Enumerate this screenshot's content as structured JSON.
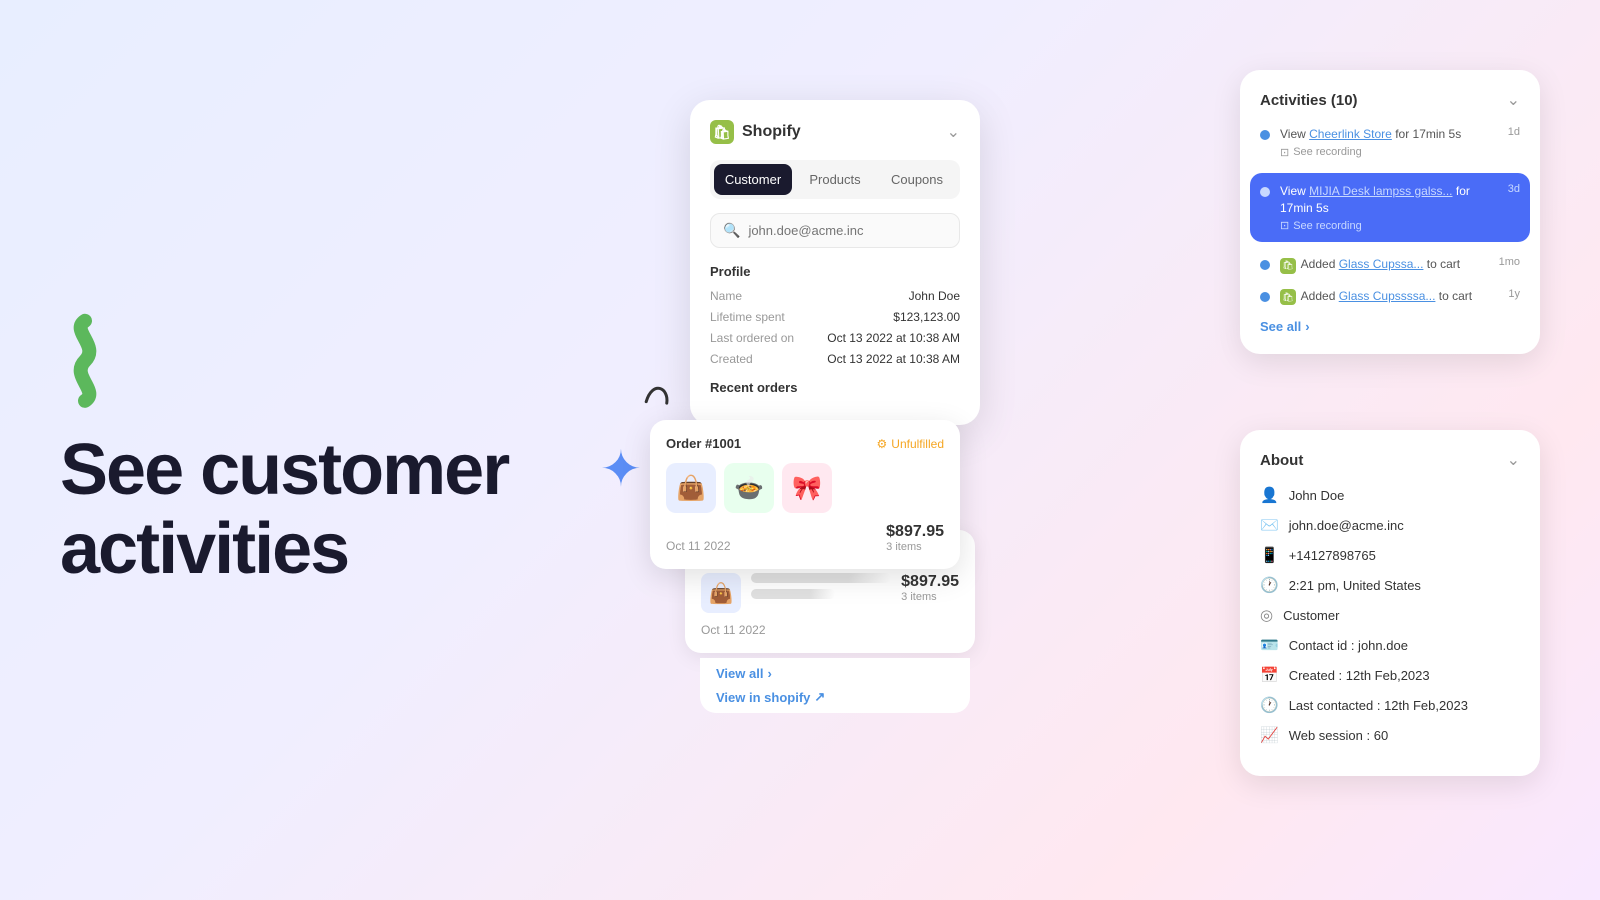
{
  "hero": {
    "title_line1": "See customer",
    "title_line2": "activities"
  },
  "shopify_card": {
    "logo": "Shopify",
    "tabs": [
      "Customer",
      "Products",
      "Coupons"
    ],
    "active_tab": "Customer",
    "search_placeholder": "john.doe@acme.inc",
    "profile": {
      "title": "Profile",
      "fields": [
        {
          "label": "Name",
          "value": "John Doe"
        },
        {
          "label": "Lifetime spent",
          "value": "$123,123.00"
        },
        {
          "label": "Last ordered on",
          "value": "Oct 13 2022 at 10:38 AM"
        },
        {
          "label": "Created",
          "value": "Oct 13 2022 at 10:38 AM"
        }
      ]
    },
    "recent_orders_title": "Recent orders"
  },
  "order_main": {
    "number": "Order #1001",
    "status": "Unfulfilled",
    "price": "$897.95",
    "items": "3 items",
    "date": "Oct 11 2022",
    "emojis": [
      "👜",
      "🍲",
      "🎀"
    ]
  },
  "order_secondary": {
    "number": "Order #1001",
    "status": "Unfulfilled",
    "price": "$897.95",
    "items": "3 items",
    "date": "Oct 11 2022"
  },
  "view_links": {
    "view_all": "View all",
    "view_in_shopify": "View in shopify"
  },
  "activities": {
    "title": "Activities (10)",
    "items": [
      {
        "text_prefix": "View",
        "link": "Cheerlink Store",
        "text_suffix": "for 17min 5s",
        "recording": "See recording",
        "time": "1d",
        "highlighted": false
      },
      {
        "text_prefix": "View",
        "link": "MIJIA Desk lampss galss...",
        "text_suffix": "for 17min 5s",
        "recording": "See recording",
        "time": "3d",
        "highlighted": true
      },
      {
        "text_prefix": "Added",
        "link": "Glass Cupssa...",
        "text_suffix": "to cart",
        "recording": "",
        "time": "1mo",
        "highlighted": false
      },
      {
        "text_prefix": "Added",
        "link": "Glass Cupssssa...",
        "text_suffix": "to cart",
        "recording": "",
        "time": "1y",
        "highlighted": false
      }
    ],
    "see_all": "See all"
  },
  "about": {
    "title": "About",
    "rows": [
      {
        "icon": "👤",
        "text": "John Doe"
      },
      {
        "icon": "✉️",
        "text": "john.doe@acme.inc"
      },
      {
        "icon": "📱",
        "text": "+14127898765"
      },
      {
        "icon": "🕐",
        "text": "2:21 pm, United States"
      },
      {
        "icon": "⊙",
        "text": "Customer"
      },
      {
        "icon": "🪪",
        "text": "Contact id : john.doe"
      },
      {
        "icon": "📅",
        "text": "Created : 12th Feb,2023"
      },
      {
        "icon": "🕐",
        "text": "Last contacted : 12th Feb,2023"
      },
      {
        "icon": "📊",
        "text": "Web session : 60"
      }
    ]
  }
}
